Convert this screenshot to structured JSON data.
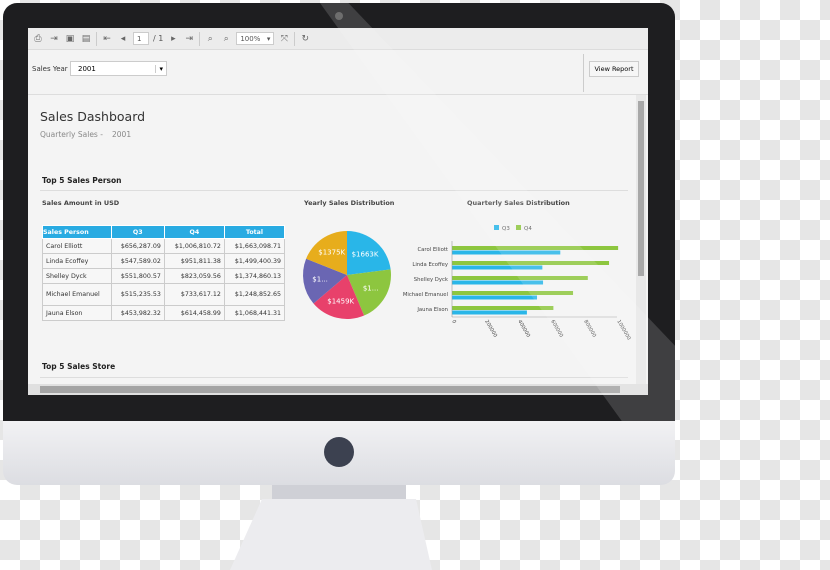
{
  "toolbar": {
    "page_current": "1",
    "page_total": "/ 1",
    "zoom": "100%",
    "icons": [
      "print-icon",
      "export-icon",
      "page-setup-icon",
      "print-layout-icon",
      "first-page-icon",
      "prev-page-icon",
      "next-page-icon",
      "last-page-icon",
      "zoom-in-icon",
      "zoom-out-icon",
      "fit-page-icon",
      "refresh-icon"
    ]
  },
  "params": {
    "label": "Sales Year",
    "value": "2001",
    "view_report": "View Report"
  },
  "report": {
    "title": "Sales Dashboard",
    "subtitle": "Quarterly Sales -",
    "year": "2001",
    "section1": "Top 5 Sales Person",
    "section2": "Top 5 Sales Store",
    "table_title": "Sales Amount in USD"
  },
  "table": {
    "headers": [
      "Sales Person",
      "Q3",
      "Q4",
      "Total"
    ],
    "rows": [
      [
        "Carol Elliott",
        "$656,287.09",
        "$1,006,810.72",
        "$1,663,098.71"
      ],
      [
        "Linda Ecoffey",
        "$547,589.02",
        "$951,811.38",
        "$1,499,400.39"
      ],
      [
        "Shelley Dyck",
        "$551,800.57",
        "$823,059.56",
        "$1,374,860.13"
      ],
      [
        "Michael Emanuel",
        "$515,235.53",
        "$733,617.12",
        "$1,248,852.65"
      ],
      [
        "Jauna Elson",
        "$453,982.32",
        "$614,458.99",
        "$1,068,441.31"
      ]
    ]
  },
  "colors": {
    "header": "#29abe2",
    "q3": "#29b6e8",
    "q4": "#8dc63f",
    "pie": [
      "#29b6e8",
      "#8dc63f",
      "#e8416b",
      "#6a66b3",
      "#e7ad1c"
    ]
  },
  "chart_data": [
    {
      "type": "pie",
      "title": "Yearly Sales Distribution",
      "categories": [
        "Carol Elliott",
        "Linda Ecoffey",
        "Jauna Elson",
        "Michael Emanuel",
        "Shelley Dyck"
      ],
      "values": [
        1663098.71,
        1499400.39,
        1459000,
        1248852.65,
        1375000
      ],
      "labels": [
        "$1663K",
        "$1...",
        "$1459K",
        "$1...",
        "$1375K"
      ]
    },
    {
      "type": "bar",
      "orientation": "horizontal",
      "title": "Quarterly Sales Distribution",
      "categories": [
        "Carol Elliott",
        "Linda Ecoffey",
        "Shelley Dyck",
        "Michael Emanuel",
        "Jauna Elson"
      ],
      "series": [
        {
          "name": "Q3",
          "values": [
            656287.09,
            547589.02,
            551800.57,
            515235.53,
            453982.32
          ]
        },
        {
          "name": "Q4",
          "values": [
            1006810.72,
            951811.38,
            823059.56,
            733617.12,
            614458.99
          ]
        }
      ],
      "xlim": [
        0,
        1000000
      ],
      "xticks": [
        "0",
        "200000",
        "400000",
        "600000",
        "800000",
        "1000000"
      ],
      "legend": "top"
    }
  ]
}
